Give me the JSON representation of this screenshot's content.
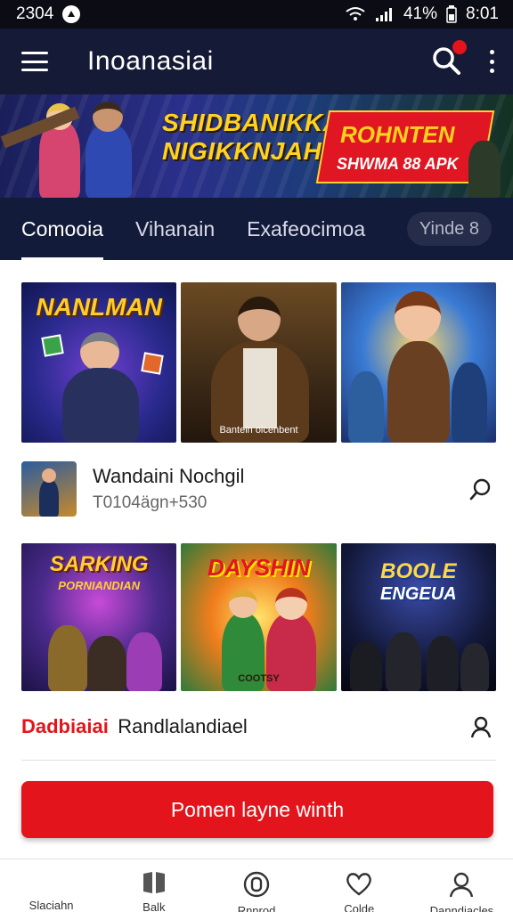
{
  "status_bar": {
    "left_text": "2304",
    "right_text": "41%",
    "time": "8:01",
    "icons": [
      "notification-icon",
      "wifi-icon",
      "signal-icon",
      "battery-icon"
    ]
  },
  "app_bar": {
    "title": "Inoanasiai",
    "icons": [
      "menu-icon",
      "search-icon",
      "more-vert-icon"
    ],
    "accent": "#e3141b"
  },
  "banner": {
    "headline_line1": "SHIDBANIKKA",
    "headline_line2": "NIGIKKNJAHN",
    "badge_title": "ROHNTEN",
    "badge_sub": "SHWMA 88 APK"
  },
  "tabs": {
    "items": [
      {
        "label": "Comooia",
        "active": true
      },
      {
        "label": "Vihanain",
        "active": false
      },
      {
        "label": "Exafeocimoa",
        "active": false
      }
    ],
    "pill": "Yinde 8"
  },
  "grid1": [
    {
      "title": "NANLMAN",
      "caption": ""
    },
    {
      "title": "",
      "caption": "Bantein oicenbent"
    },
    {
      "title": "",
      "caption": ""
    }
  ],
  "item1": {
    "title": "Wandaini Nochgil",
    "subtitle": "T0104ägn+530",
    "action_icon": "search-icon"
  },
  "grid2": [
    {
      "title": "SARKING",
      "subtitle": "PORNIANDIAN",
      "caption": ""
    },
    {
      "title": "DAYSHIN",
      "caption": "COOTSY"
    },
    {
      "title": "BOOLE",
      "subtitle": "ENGEUA",
      "caption": ""
    }
  ],
  "item2": {
    "title_accent": "Dadbiaiai",
    "title": "Randlalandiael",
    "action_icon": "person-icon"
  },
  "cta": {
    "label": "Pomen layne winth"
  },
  "bottom_nav": [
    {
      "label": "Slaciahn",
      "icon": "home-icon"
    },
    {
      "label": "Balk",
      "icon": "book-icon"
    },
    {
      "label": "Rnnrod",
      "icon": "coin-icon"
    },
    {
      "label": "Colde",
      "icon": "heart-icon"
    },
    {
      "label": "Danndiacles",
      "icon": "profile-icon"
    }
  ],
  "colors": {
    "primary": "#e3141b",
    "header_bg": "#151a36",
    "tabs_bg": "#131b3a"
  }
}
